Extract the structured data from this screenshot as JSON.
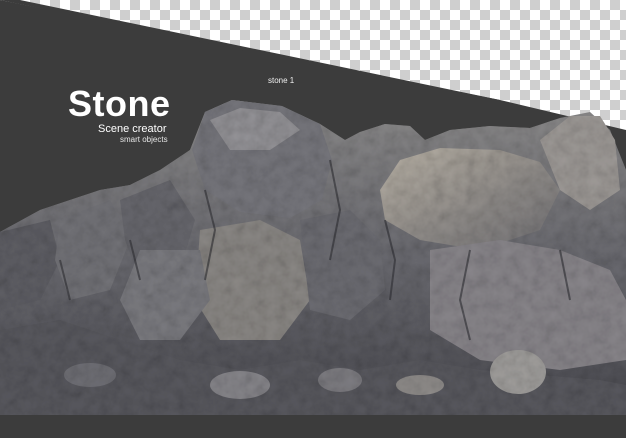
{
  "title": "Stone",
  "subtitle": "Scene creator",
  "subsubtitle": "smart objects",
  "object_label": "stone 1",
  "colors": {
    "banner": "#3c3c3c",
    "checker_light": "#ffffff",
    "checker_dark": "#cfcfcf",
    "rock_base": "#6d6d72",
    "rock_light": "#b3aea4",
    "rock_dark": "#3f3f44",
    "text": "#ffffff"
  }
}
